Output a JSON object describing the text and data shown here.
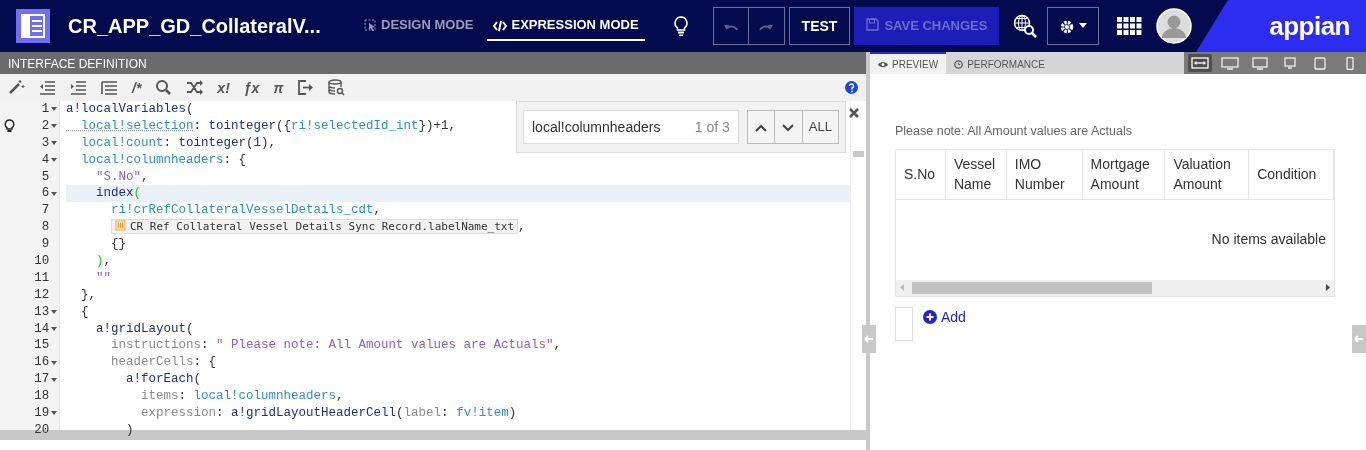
{
  "header": {
    "title": "CR_APP_GD_CollateralV...",
    "modes": [
      {
        "kind": "design",
        "label": "DESIGN MODE",
        "selected": false
      },
      {
        "kind": "expression",
        "label": "EXPRESSION MODE",
        "selected": true
      }
    ],
    "undo_disabled": true,
    "redo_disabled": true,
    "test": "TEST",
    "save": {
      "label": "SAVE CHANGES",
      "disabled": true
    },
    "logo": "appian"
  },
  "interface_definition": {
    "title": "INTERFACE DEFINITION",
    "toolbar": [
      {
        "kind": "wand"
      },
      {
        "kind": "outdent"
      },
      {
        "kind": "indent"
      },
      {
        "kind": "lines"
      },
      {
        "kind": "glyph",
        "glyph": "/*"
      },
      {
        "kind": "search"
      },
      {
        "kind": "shuffle"
      },
      {
        "kind": "glyph",
        "glyph": "x!"
      },
      {
        "kind": "glyph",
        "glyph": "ƒx"
      },
      {
        "kind": "glyph",
        "glyph": "π"
      },
      {
        "kind": "export"
      },
      {
        "kind": "db"
      }
    ],
    "find": {
      "value": "local!columnheaders",
      "count": "1 of 3",
      "all": "ALL"
    },
    "lines": [
      {
        "number": "1",
        "fold": true,
        "current": false,
        "hint": false,
        "tokens": [
          {
            "kind": "fn",
            "text": "a!localVariables"
          },
          {
            "kind": "punct",
            "text": "("
          }
        ]
      },
      {
        "number": "2",
        "fold": true,
        "current": false,
        "hint": true,
        "tokens": [
          {
            "kind": "var",
            "text": "  local!selection",
            "warning": true
          },
          {
            "kind": "punct",
            "text": ": "
          },
          {
            "kind": "fn",
            "text": "tointeger"
          },
          {
            "kind": "punct",
            "text": "({"
          },
          {
            "kind": "var",
            "text": "ri!selectedId_int"
          },
          {
            "kind": "punct",
            "text": "})+1,"
          }
        ]
      },
      {
        "number": "3",
        "fold": true,
        "current": false,
        "hint": false,
        "tokens": [
          {
            "kind": "var",
            "text": "  local!count"
          },
          {
            "kind": "punct",
            "text": ": "
          },
          {
            "kind": "fn",
            "text": "tointeger"
          },
          {
            "kind": "punct",
            "text": "("
          },
          {
            "kind": "num",
            "text": "1"
          },
          {
            "kind": "punct",
            "text": "),"
          }
        ]
      },
      {
        "number": "4",
        "fold": true,
        "current": false,
        "hint": false,
        "tokens": [
          {
            "kind": "var",
            "text": "  local!columnheaders"
          },
          {
            "kind": "punct",
            "text": ": {"
          }
        ]
      },
      {
        "number": "5",
        "fold": false,
        "current": false,
        "hint": false,
        "tokens": [
          {
            "kind": "str",
            "text": "    \"S.No\""
          },
          {
            "kind": "punct",
            "text": ","
          }
        ]
      },
      {
        "number": "6",
        "fold": true,
        "current": true,
        "hint": false,
        "tokens": [
          {
            "kind": "fn",
            "text": "    index"
          },
          {
            "kind": "match",
            "text": "("
          }
        ]
      },
      {
        "number": "7",
        "fold": false,
        "current": false,
        "hint": false,
        "tokens": [
          {
            "kind": "var",
            "text": "      ri!crRefCollateralVesselDetails_cdt"
          },
          {
            "kind": "punct",
            "text": ","
          }
        ]
      },
      {
        "number": "8",
        "fold": false,
        "current": false,
        "hint": false,
        "tokens": [
          {
            "kind": "record",
            "text": "CR Ref Collateral Vessel Details Sync Record.labelName_txt"
          },
          {
            "kind": "punct",
            "text": ","
          }
        ]
      },
      {
        "number": "9",
        "fold": false,
        "current": false,
        "hint": false,
        "tokens": [
          {
            "kind": "punct",
            "text": "      {}"
          }
        ]
      },
      {
        "number": "10",
        "fold": false,
        "current": false,
        "hint": false,
        "tokens": [
          {
            "kind": "match",
            "text": "    )"
          },
          {
            "kind": "punct",
            "text": ","
          }
        ]
      },
      {
        "number": "11",
        "fold": false,
        "current": false,
        "hint": false,
        "tokens": [
          {
            "kind": "str",
            "text": "    \"\""
          }
        ]
      },
      {
        "number": "12",
        "fold": false,
        "current": false,
        "hint": false,
        "tokens": [
          {
            "kind": "punct",
            "text": "  },"
          }
        ]
      },
      {
        "number": "13",
        "fold": true,
        "current": false,
        "hint": false,
        "tokens": [
          {
            "kind": "punct",
            "text": "  {"
          }
        ]
      },
      {
        "number": "14",
        "fold": true,
        "current": false,
        "hint": false,
        "tokens": [
          {
            "kind": "fn",
            "text": "    a!gridLayout"
          },
          {
            "kind": "punct",
            "text": "("
          }
        ]
      },
      {
        "number": "15",
        "fold": false,
        "current": false,
        "hint": false,
        "tokens": [
          {
            "kind": "param",
            "text": "      instructions"
          },
          {
            "kind": "punct",
            "text": ": "
          },
          {
            "kind": "str",
            "text": "\" Please note: All Amount values are Actuals\""
          },
          {
            "kind": "punct",
            "text": ","
          }
        ]
      },
      {
        "number": "16",
        "fold": true,
        "current": false,
        "hint": false,
        "tokens": [
          {
            "kind": "param",
            "text": "      headerCells"
          },
          {
            "kind": "punct",
            "text": ": {"
          }
        ]
      },
      {
        "number": "17",
        "fold": true,
        "current": false,
        "hint": false,
        "tokens": [
          {
            "kind": "fn",
            "text": "        a!forEach"
          },
          {
            "kind": "punct",
            "text": "("
          }
        ]
      },
      {
        "number": "18",
        "fold": false,
        "current": false,
        "hint": false,
        "tokens": [
          {
            "kind": "param",
            "text": "          items"
          },
          {
            "kind": "punct",
            "text": ": "
          },
          {
            "kind": "var",
            "text": "local!columnheaders"
          },
          {
            "kind": "punct",
            "text": ","
          }
        ]
      },
      {
        "number": "19",
        "fold": true,
        "current": false,
        "hint": false,
        "tokens": [
          {
            "kind": "param",
            "text": "          expression"
          },
          {
            "kind": "punct",
            "text": ": "
          },
          {
            "kind": "fn",
            "text": "a!gridLayoutHeaderCell"
          },
          {
            "kind": "punct",
            "text": "("
          },
          {
            "kind": "param",
            "text": "label"
          },
          {
            "kind": "punct",
            "text": ": "
          },
          {
            "kind": "var",
            "text": "fv!item"
          },
          {
            "kind": "punct",
            "text": ")"
          }
        ]
      },
      {
        "number": "20",
        "fold": false,
        "current": false,
        "hint": false,
        "tokens": [
          {
            "kind": "punct",
            "text": "        )"
          }
        ]
      }
    ]
  },
  "preview": {
    "tabs": [
      {
        "kind": "preview",
        "label": "PREVIEW",
        "selected": true
      },
      {
        "kind": "performance",
        "label": "PERFORMANCE",
        "selected": false
      }
    ],
    "devices": [
      {
        "kind": "fit",
        "selected": true
      },
      {
        "kind": "wide",
        "selected": false
      },
      {
        "kind": "desktop",
        "selected": false
      },
      {
        "kind": "monitor",
        "selected": false
      },
      {
        "kind": "tablet",
        "selected": false
      },
      {
        "kind": "phone",
        "selected": false
      }
    ],
    "instructions": "Please note: All Amount values are Actuals",
    "columns": [
      [
        "S.No"
      ],
      [
        "Vessel",
        "Name"
      ],
      [
        "IMO",
        "Number"
      ],
      [
        "Mortgage",
        "Amount"
      ],
      [
        "Valuation",
        "Amount"
      ],
      [
        "Condition"
      ]
    ],
    "empty": "No items available",
    "add": "Add"
  }
}
